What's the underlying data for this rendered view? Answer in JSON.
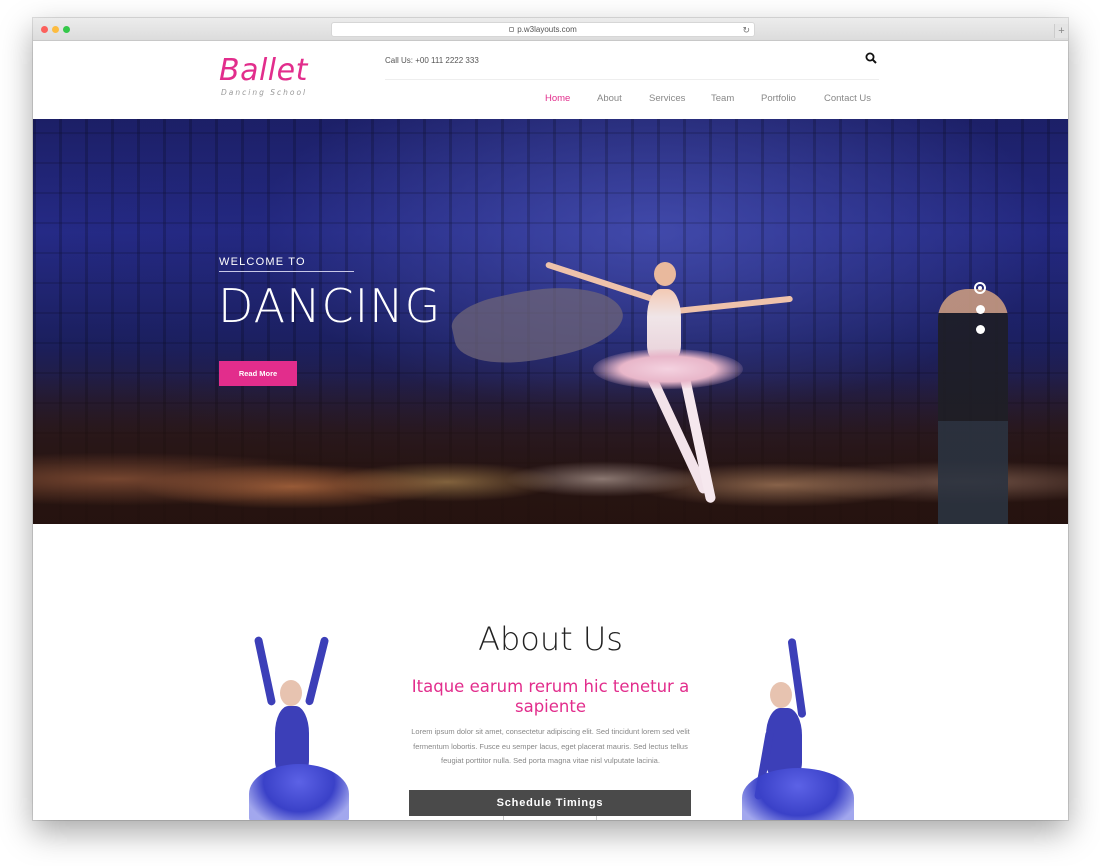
{
  "browser": {
    "url": "p.w3layouts.com"
  },
  "brand": {
    "name": "Ballet",
    "tagline": "Dancing School"
  },
  "header": {
    "call_us": "Call Us: +00 111 2222 333"
  },
  "nav": {
    "items": [
      {
        "label": "Home",
        "active": true
      },
      {
        "label": "About",
        "active": false
      },
      {
        "label": "Services",
        "active": false
      },
      {
        "label": "Team",
        "active": false
      },
      {
        "label": "Portfolio",
        "active": false
      },
      {
        "label": "Contact Us",
        "active": false
      }
    ]
  },
  "hero": {
    "welcome": "WELCOME TO",
    "title": "DANCING",
    "button": "Read More",
    "slides": 3,
    "active_slide": 1
  },
  "about": {
    "title": "About Us",
    "subtitle": "Itaque earum rerum hic tenetur a sapiente",
    "body": "Lorem ipsum dolor sit amet, consectetur adipiscing elit. Sed tincidunt lorem sed velit fermentum lobortis. Fusce eu semper lacus, eget placerat mauris. Sed lectus tellus feugiat porttitor nulla. Sed porta magna vitae nisl vulputate lacinia.",
    "schedule_button": "Schedule Timings"
  },
  "colors": {
    "accent": "#e22d8c",
    "dark_button": "#4a4a4a"
  },
  "icons": [
    "lock-icon",
    "reload-icon",
    "search-icon"
  ]
}
